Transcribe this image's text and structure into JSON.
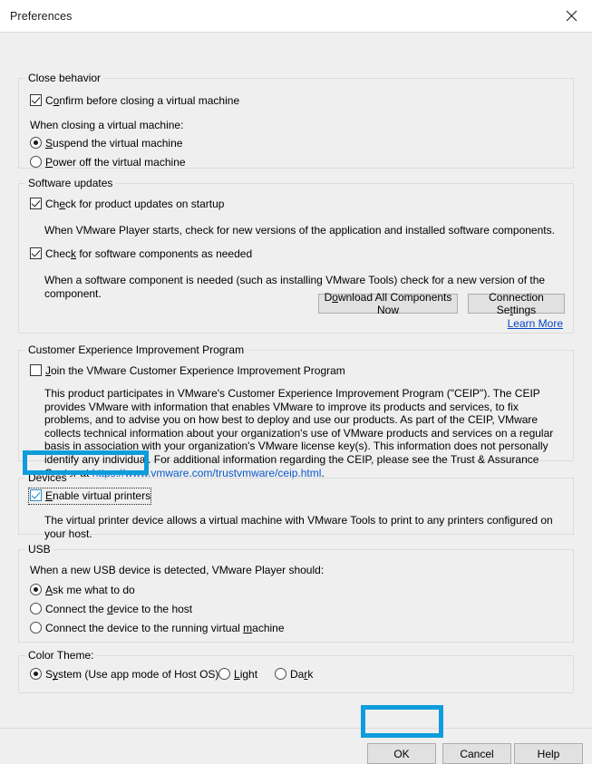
{
  "window": {
    "title": "Preferences",
    "close_icon": "close-icon"
  },
  "sections": {
    "close_behavior": {
      "title": "Close behavior",
      "confirm_checkbox": {
        "label_pre": "C",
        "label_acc": "o",
        "label_post": "nfirm before closing a virtual machine",
        "full_label": "Confirm before closing a virtual machine",
        "checked": true
      },
      "prompt": "When closing a virtual machine:",
      "radios": [
        {
          "full_label": "Suspend the virtual machine",
          "acc": "S",
          "rest": "uspend the virtual machine",
          "selected": true
        },
        {
          "full_label": "Power off the virtual machine",
          "acc": "P",
          "rest": "ower off the virtual machine",
          "selected": false
        }
      ]
    },
    "software_updates": {
      "title": "Software updates",
      "check_product": {
        "pre": "Ch",
        "acc": "e",
        "post": "ck for product updates on startup",
        "full_label": "Check for product updates on startup",
        "checked": true
      },
      "product_desc": "When VMware Player starts, check for new versions of the application and installed software components.",
      "check_components": {
        "pre": "Chec",
        "acc": "k",
        "post": " for software components as needed",
        "full_label": "Check for software components as needed",
        "checked": true
      },
      "components_desc": "When a software component is needed (such as installing VMware Tools) check for a new version of the component.",
      "download_button": {
        "pre": "D",
        "acc": "o",
        "post": "wnload All Components Now",
        "full_label": "Download All Components Now"
      },
      "connection_button": {
        "pre": "Connection Se",
        "acc": "t",
        "post": "tings",
        "full_label": "Connection Settings"
      },
      "learn_more": "Learn More"
    },
    "ceip": {
      "title": "Customer Experience Improvement Program",
      "join_checkbox": {
        "acc": "J",
        "rest": "oin the VMware Customer Experience Improvement Program",
        "full_label": "Join the VMware Customer Experience Improvement Program",
        "checked": false
      },
      "paragraph_before": "This product participates in VMware's Customer Experience Improvement Program (\"CEIP\"). The CEIP provides VMware with information that enables VMware to improve its products and services, to fix problems, and to advise you on how best to deploy and use our products. As part of the CEIP, VMware collects technical information about your organization's use of VMware products and services on a regular basis in association with your organization's VMware license key(s). This information does not personally identify any individual. For additional information regarding the CEIP, please see the Trust & Assurance Center at ",
      "link_text": "https://www.vmware.com/trustvmware/ceip.html",
      "paragraph_after": "."
    },
    "devices": {
      "title": "Devices",
      "enable_printers": {
        "acc": "E",
        "rest": "nable virtual printers",
        "full_label": "Enable virtual printers",
        "checked": true,
        "focused": true,
        "highlighted": true
      },
      "description": "The virtual printer device allows a virtual machine with VMware Tools to print to any printers configured on your host."
    },
    "usb": {
      "title": "USB",
      "prompt": "When a new USB device is detected, VMware Player should:",
      "radios": [
        {
          "acc": "A",
          "rest": "sk me what to do",
          "full_label": "Ask me what to do",
          "selected": true
        },
        {
          "pre": "Connect the ",
          "acc": "d",
          "post": "evice to the host",
          "full_label": "Connect the device to the host",
          "selected": false
        },
        {
          "pre": "Connect the device to the running virtual ",
          "acc": "m",
          "post": "achine",
          "full_label": "Connect the device to the running virtual machine",
          "selected": false
        }
      ]
    },
    "color_theme": {
      "title": "Color Theme:",
      "radios": [
        {
          "pre": "S",
          "acc": "y",
          "post": "stem (Use app mode of Host OS)",
          "full_label": "System (Use app mode of Host OS)",
          "selected": true
        },
        {
          "acc": "L",
          "rest": "ight",
          "full_label": "Light",
          "selected": false
        },
        {
          "pre": "Da",
          "acc": "r",
          "post": "k",
          "full_label": "Dark",
          "selected": false
        }
      ]
    }
  },
  "footer": {
    "ok": "OK",
    "cancel": "Cancel",
    "help": "Help",
    "ok_highlighted": true
  },
  "colors": {
    "annotation_blue": "#0d9ddb",
    "link_blue": "#0645c1",
    "dialog_bg": "#efefef",
    "titlebar_bg": "#ffffff",
    "button_bg": "#e1e1e1",
    "group_border": "#dcdcdc"
  }
}
